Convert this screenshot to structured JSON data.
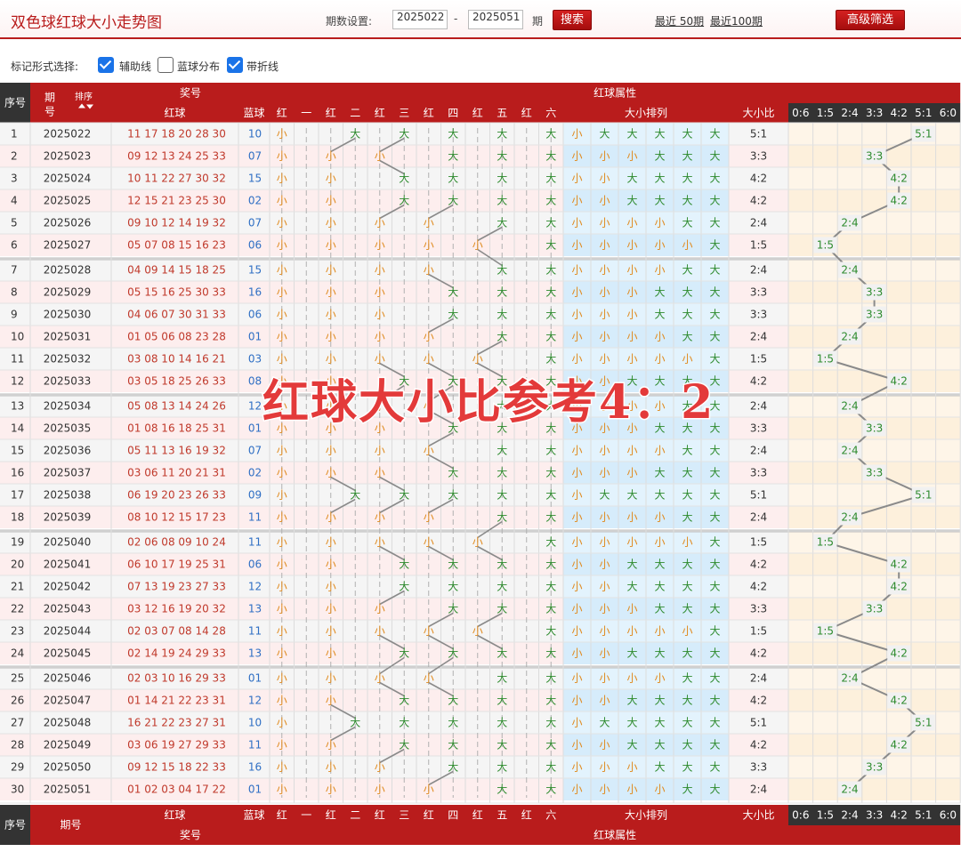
{
  "header": {
    "title": "双色球红球大小走势图",
    "range_label": "期数设置:",
    "range_from": "2025022",
    "range_to": "2025051",
    "range_dash": "-",
    "range_unit": "期",
    "search_label": "搜索",
    "recent_50": "最近 50期",
    "recent_100": "最近100期",
    "advanced_label": "高级筛选"
  },
  "options": {
    "label": "标记形式选择:",
    "items": [
      {
        "label": "辅助线",
        "checked": true
      },
      {
        "label": "蓝球分布",
        "checked": false
      },
      {
        "label": "带折线",
        "checked": true
      }
    ]
  },
  "columns": {
    "index": "序号",
    "period": "期号",
    "sort": "排序",
    "draw_group": "奖号",
    "red": "红球",
    "blue": "蓝球",
    "attr_group": "红球属性",
    "positions": [
      "红",
      "一",
      "红",
      "二",
      "红",
      "三",
      "红",
      "四",
      "红",
      "五",
      "红",
      "六"
    ],
    "size_seq": "大小排列",
    "size_ratio": "大小比",
    "ratios": [
      "0:6",
      "1:5",
      "2:4",
      "3:3",
      "4:2",
      "5:1",
      "6:0"
    ]
  },
  "labels": {
    "small": "小",
    "big": "大"
  },
  "watermark": "红球大小比参考4：2",
  "colors": {
    "accent": "#b91c1c",
    "red_number": "#c0392b",
    "blue_number": "#2f6fc4",
    "small": "#e08a1e",
    "big": "#2e8b2e"
  },
  "rows": [
    {
      "no": "1",
      "period": "2025022",
      "red": "11 17 18 20 28 30",
      "blue": "10",
      "ratio": "5:1"
    },
    {
      "no": "2",
      "period": "2025023",
      "red": "09 12 13 24 25 33",
      "blue": "07",
      "ratio": "3:3"
    },
    {
      "no": "3",
      "period": "2025024",
      "red": "10 11 22 27 30 32",
      "blue": "15",
      "ratio": "4:2"
    },
    {
      "no": "4",
      "period": "2025025",
      "red": "12 15 21 23 25 30",
      "blue": "02",
      "ratio": "4:2"
    },
    {
      "no": "5",
      "period": "2025026",
      "red": "09 10 12 14 19 32",
      "blue": "07",
      "ratio": "2:4"
    },
    {
      "no": "6",
      "period": "2025027",
      "red": "05 07 08 15 16 23",
      "blue": "06",
      "ratio": "1:5"
    },
    {
      "no": "7",
      "period": "2025028",
      "red": "04 09 14 15 18 25",
      "blue": "15",
      "ratio": "2:4"
    },
    {
      "no": "8",
      "period": "2025029",
      "red": "05 15 16 25 30 33",
      "blue": "16",
      "ratio": "3:3"
    },
    {
      "no": "9",
      "period": "2025030",
      "red": "04 06 07 30 31 33",
      "blue": "06",
      "ratio": "3:3"
    },
    {
      "no": "10",
      "period": "2025031",
      "red": "01 05 06 08 23 28",
      "blue": "01",
      "ratio": "2:4"
    },
    {
      "no": "11",
      "period": "2025032",
      "red": "03 08 10 14 16 21",
      "blue": "03",
      "ratio": "1:5"
    },
    {
      "no": "12",
      "period": "2025033",
      "red": "03 05 18 25 26 33",
      "blue": "08",
      "ratio": "4:2"
    },
    {
      "no": "13",
      "period": "2025034",
      "red": "05 08 13 14 24 26",
      "blue": "12",
      "ratio": "2:4"
    },
    {
      "no": "14",
      "period": "2025035",
      "red": "01 08 16 18 25 31",
      "blue": "01",
      "ratio": "3:3"
    },
    {
      "no": "15",
      "period": "2025036",
      "red": "05 11 13 16 19 32",
      "blue": "07",
      "ratio": "2:4"
    },
    {
      "no": "16",
      "period": "2025037",
      "red": "03 06 11 20 21 31",
      "blue": "02",
      "ratio": "3:3"
    },
    {
      "no": "17",
      "period": "2025038",
      "red": "06 19 20 23 26 33",
      "blue": "09",
      "ratio": "5:1"
    },
    {
      "no": "18",
      "period": "2025039",
      "red": "08 10 12 15 17 23",
      "blue": "11",
      "ratio": "2:4"
    },
    {
      "no": "19",
      "period": "2025040",
      "red": "02 06 08 09 10 24",
      "blue": "11",
      "ratio": "1:5"
    },
    {
      "no": "20",
      "period": "2025041",
      "red": "06 10 17 19 25 31",
      "blue": "06",
      "ratio": "4:2"
    },
    {
      "no": "21",
      "period": "2025042",
      "red": "07 13 19 23 27 33",
      "blue": "12",
      "ratio": "4:2"
    },
    {
      "no": "22",
      "period": "2025043",
      "red": "03 12 16 19 20 32",
      "blue": "13",
      "ratio": "3:3"
    },
    {
      "no": "23",
      "period": "2025044",
      "red": "02 03 07 08 14 28",
      "blue": "11",
      "ratio": "1:5"
    },
    {
      "no": "24",
      "period": "2025045",
      "red": "02 14 19 24 29 33",
      "blue": "13",
      "ratio": "4:2"
    },
    {
      "no": "25",
      "period": "2025046",
      "red": "02 03 10 16 29 33",
      "blue": "01",
      "ratio": "2:4"
    },
    {
      "no": "26",
      "period": "2025047",
      "red": "01 14 21 22 23 31",
      "blue": "12",
      "ratio": "4:2"
    },
    {
      "no": "27",
      "period": "2025048",
      "red": "16 21 22 23 27 31",
      "blue": "10",
      "ratio": "5:1"
    },
    {
      "no": "28",
      "period": "2025049",
      "red": "03 06 19 27 29 33",
      "blue": "11",
      "ratio": "4:2"
    },
    {
      "no": "29",
      "period": "2025050",
      "red": "09 12 15 18 22 33",
      "blue": "16",
      "ratio": "3:3"
    },
    {
      "no": "30",
      "period": "2025051",
      "red": "01 02 03 04 17 22",
      "blue": "01",
      "ratio": "2:4"
    }
  ]
}
